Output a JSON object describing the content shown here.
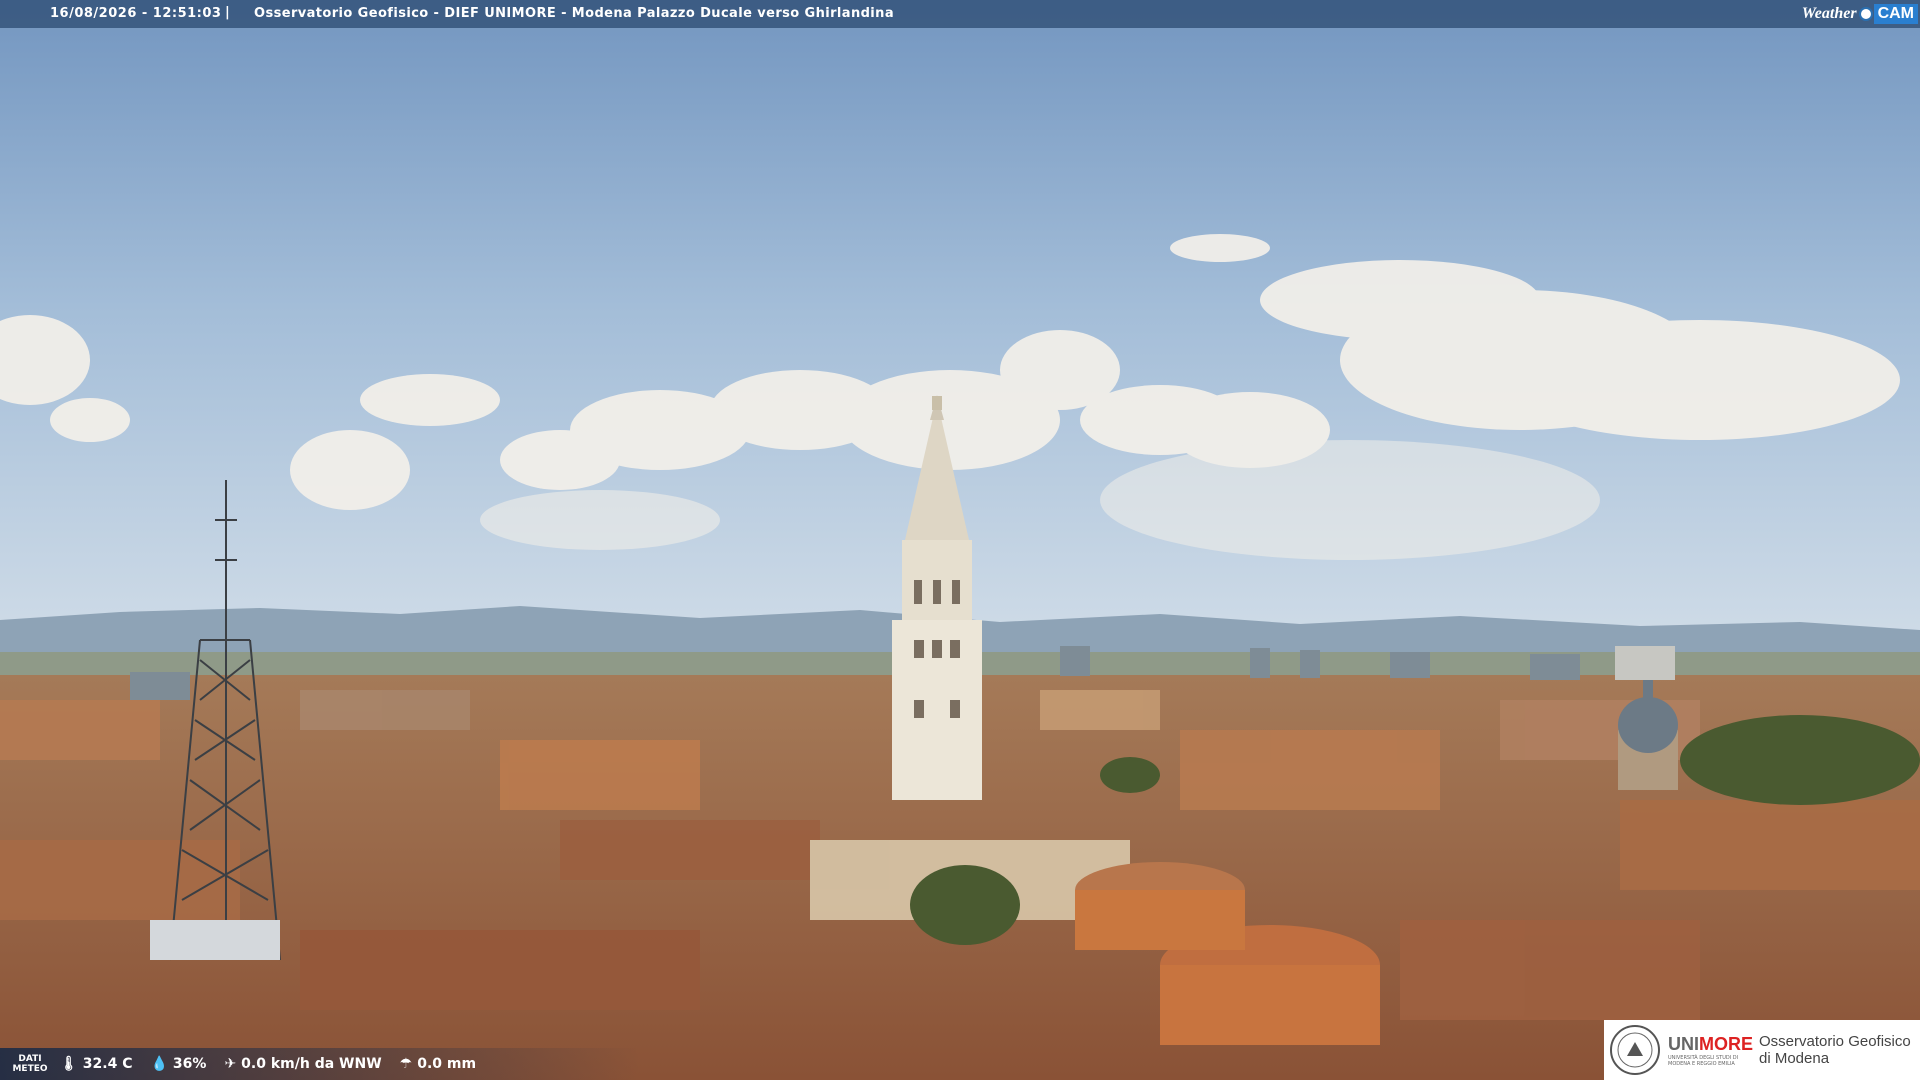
{
  "overlay": {
    "datetime": "16/08/2026 - 12:51:03",
    "separator": "|",
    "title": "Osservatorio Geofisico - DIEF UNIMORE - Modena Palazzo Ducale verso Ghirlandina"
  },
  "brand": {
    "weather": "Weather",
    "cam": "CAM"
  },
  "meteo": {
    "label": "DATI METEO",
    "temperature": "32.4 C",
    "humidity": "36%",
    "wind": "0.0 km/h da WNW",
    "rain": "0.0 mm",
    "icons": [
      "thermometer-icon",
      "humidity-icon",
      "wind-icon",
      "rain-icon"
    ]
  },
  "logo": {
    "uni": "UNI",
    "more": "MORE",
    "university": "UNIVERSITÀ DEGLI STUDI DI MODENA E REGGIO EMILIA",
    "obs_line1": "Osservatorio Geofisico",
    "obs_line2": "di Modena"
  },
  "colors": {
    "sky_top": "#7a9ec6",
    "sky_bottom": "#c9d8e6",
    "roofs": "#b4754a",
    "tower": "#e8e2d4",
    "accent_red": "#dd2222"
  }
}
